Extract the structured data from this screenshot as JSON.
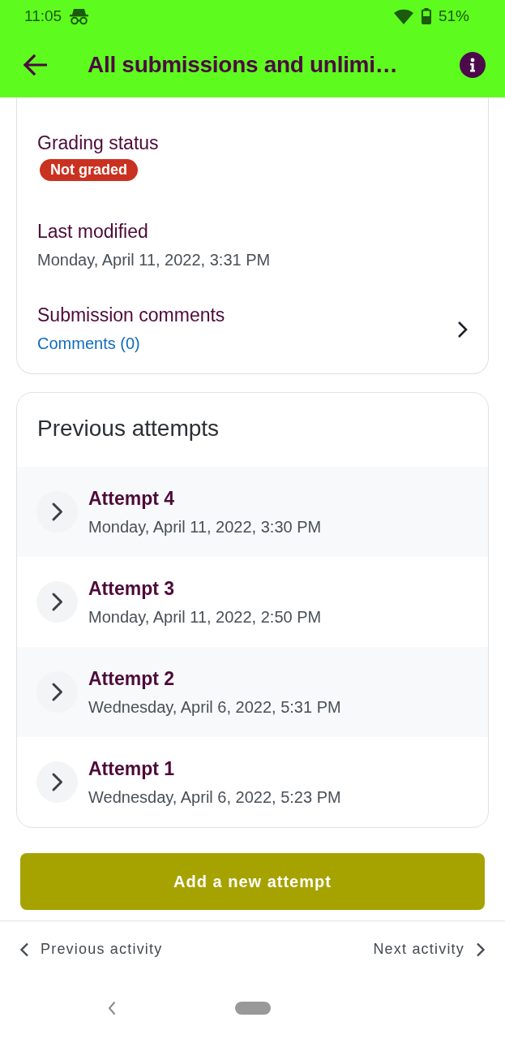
{
  "status_bar": {
    "time": "11:05",
    "battery": "51%"
  },
  "app_bar": {
    "title": "All submissions and unlimi…"
  },
  "submission_fields": [
    {
      "kind": "badge",
      "label": "Grading status",
      "value": "Not graded"
    },
    {
      "kind": "text",
      "label": "Last modified",
      "value": "Monday, April 11, 2022, 3:31 PM"
    },
    {
      "kind": "link",
      "label": "Submission comments",
      "value": "Comments (0)"
    }
  ],
  "previous_attempts": {
    "title": "Previous attempts",
    "attempts": [
      {
        "title": "Attempt 4",
        "date": "Monday, April 11, 2022, 3:30 PM"
      },
      {
        "title": "Attempt 3",
        "date": "Monday, April 11, 2022, 2:50 PM"
      },
      {
        "title": "Attempt 2",
        "date": "Wednesday, April 6, 2022, 5:31 PM"
      },
      {
        "title": "Attempt 1",
        "date": "Wednesday, April 6, 2022, 5:23 PM"
      }
    ]
  },
  "add_attempt_button": "Add a new attempt",
  "activity_navigation": {
    "previous": "Previous activity",
    "next": "Next activity"
  }
}
